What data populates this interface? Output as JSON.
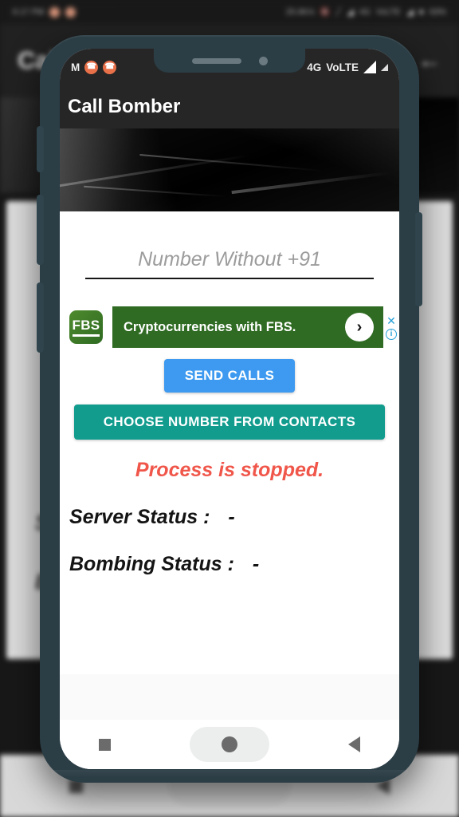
{
  "background": {
    "statusbar": {
      "time": "6:17 PM",
      "network_speed": "25.6K/s",
      "mute_icon": "mute-icon",
      "flash_icon": "flash-icon",
      "signal_icon": "signal-icon",
      "network_type": "4G",
      "volte": "VoLTE",
      "signal2_icon": "signal-icon",
      "battery_icon": "battery-icon",
      "battery_pct": "63%"
    },
    "appbar": {
      "title": "Call Bomber",
      "back_icon": "back-arrow-icon"
    },
    "card": {
      "server_status_initial": "S",
      "bombing_status_initial": "B"
    },
    "navbar": {
      "recents_icon": "square-recents-icon",
      "home_icon": "circle-home-icon",
      "back_icon": "triangle-back-icon"
    }
  },
  "phone": {
    "statusbar": {
      "carrier": "M",
      "call_icon_1": "missed-call-icon",
      "call_icon_2": "call-blocked-icon",
      "network_type": "4G",
      "volte": "VoLTE",
      "signal_icon": "signal-icon",
      "signal_icon_2": "signal-icon"
    },
    "notch": {
      "speaker_icon": "speaker-grille-icon",
      "camera_icon": "front-camera-icon"
    },
    "appbar": {
      "title": "Call Bomber"
    },
    "hero": {
      "alt": "abstract-dark-banner-image"
    },
    "form": {
      "number_placeholder": "Number Without +91",
      "number_value": ""
    },
    "ad": {
      "logo_text": "FBS",
      "headline": "Cryptocurrencies with FBS.",
      "arrow_icon": "chevron-right-icon",
      "close_icon": "close-icon",
      "info_icon": "ad-info-icon"
    },
    "buttons": {
      "send_calls": "SEND CALLS",
      "choose_contacts": "CHOOSE NUMBER FROM CONTACTS"
    },
    "status": {
      "process": "Process is stopped.",
      "server_label": "Server Status :",
      "server_value": "-",
      "bombing_label": "Bombing Status :",
      "bombing_value": "-"
    },
    "navbar": {
      "recents_icon": "square-recents-icon",
      "home_icon": "circle-home-icon",
      "back_icon": "triangle-back-icon"
    }
  },
  "colors": {
    "phone_frame": "#2b3d45",
    "appbar": "#262626",
    "send_calls": "#3d9af0",
    "choose_contacts": "#119c8e",
    "error_text": "#f0564a",
    "ad_green": "#2f6b22",
    "ad_accent": "#27a2d8"
  }
}
